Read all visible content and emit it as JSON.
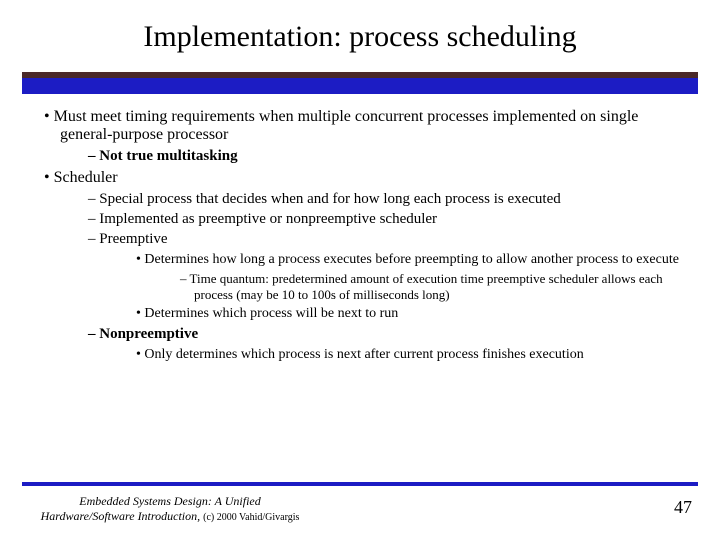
{
  "title": "Implementation: process scheduling",
  "bullets": {
    "b1": "Must meet timing requirements when multiple concurrent processes implemented on single general-purpose processor",
    "b1_1": "Not true multitasking",
    "b2": "Scheduler",
    "b2_1": "Special process that decides when and for how long each process is executed",
    "b2_2": "Implemented as preemptive or nonpreemptive scheduler",
    "b2_3": "Preemptive",
    "b2_3_1": "Determines how long a process executes before preempting to allow another process to execute",
    "b2_3_1_1": "Time quantum: predetermined amount of execution time preemptive scheduler allows each process (may be 10 to 100s of milliseconds long)",
    "b2_3_2": "Determines which process will be next to run",
    "b2_4": "Nonpreemptive",
    "b2_4_1": "Only determines which process is next after current process finishes execution"
  },
  "footer": {
    "line1": "Embedded Systems Design: A Unified",
    "line2_prefix": "Hardware/Software Introduction, ",
    "attribution": "(c) 2000 Vahid/Givargis"
  },
  "page_number": "47"
}
